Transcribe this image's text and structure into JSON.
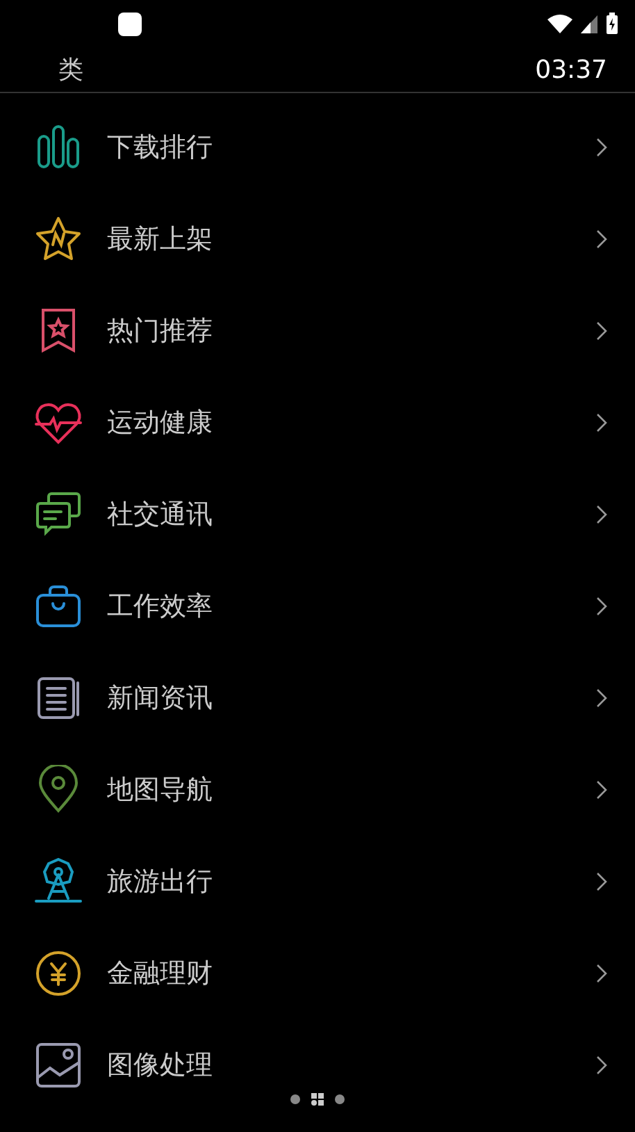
{
  "header": {
    "title": "类",
    "time": "03:37"
  },
  "categories": [
    {
      "label": "下载排行",
      "color": "#1a9c8a"
    },
    {
      "label": "最新上架",
      "color": "#d4a22a"
    },
    {
      "label": "热门推荐",
      "color": "#d9506a"
    },
    {
      "label": "运动健康",
      "color": "#e8305a"
    },
    {
      "label": "社交通讯",
      "color": "#5aa84a"
    },
    {
      "label": "工作效率",
      "color": "#2a8fd8"
    },
    {
      "label": "新闻资讯",
      "color": "#9a9ab0"
    },
    {
      "label": "地图导航",
      "color": "#5a8a3a"
    },
    {
      "label": "旅游出行",
      "color": "#1a9cc0"
    },
    {
      "label": "金融理财",
      "color": "#d4a22a"
    },
    {
      "label": "图像处理",
      "color": "#9a9ab0"
    }
  ],
  "pager": [
    {
      "selected": false
    },
    {
      "selected": true
    },
    {
      "selected": false
    }
  ]
}
